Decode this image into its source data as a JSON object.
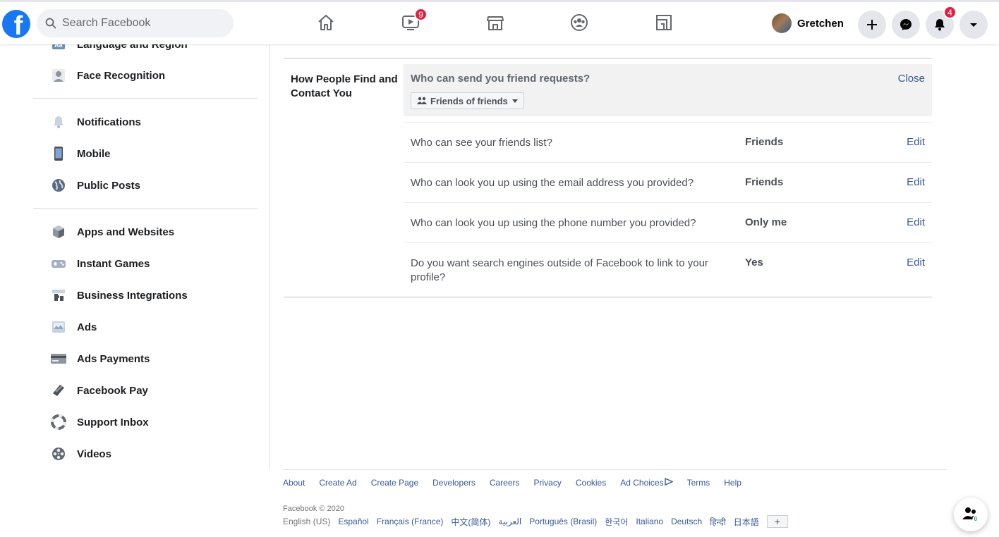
{
  "header": {
    "logo_letter": "f",
    "search_placeholder": "Search Facebook",
    "watch_badge": "9",
    "profile_name": "Gretchen",
    "notifications_badge": "4"
  },
  "sidebar": {
    "items": [
      {
        "label": "Language and Region",
        "icon": "language-icon"
      },
      {
        "label": "Face Recognition",
        "icon": "face-recognition-icon"
      },
      {
        "label": "Notifications",
        "icon": "bell-icon"
      },
      {
        "label": "Mobile",
        "icon": "mobile-icon"
      },
      {
        "label": "Public Posts",
        "icon": "globe-icon"
      },
      {
        "label": "Apps and Websites",
        "icon": "cube-icon"
      },
      {
        "label": "Instant Games",
        "icon": "gamepad-icon"
      },
      {
        "label": "Business Integrations",
        "icon": "puzzle-icon"
      },
      {
        "label": "Ads",
        "icon": "ads-icon"
      },
      {
        "label": "Ads Payments",
        "icon": "credit-card-icon"
      },
      {
        "label": "Facebook Pay",
        "icon": "pay-icon"
      },
      {
        "label": "Support Inbox",
        "icon": "lifebuoy-icon"
      },
      {
        "label": "Videos",
        "icon": "film-reel-icon"
      }
    ]
  },
  "main": {
    "section_title": "How People Find and Contact You",
    "open_question": "Who can send you friend requests?",
    "close_label": "Close",
    "dropdown_value": "Friends of friends",
    "rows": [
      {
        "question": "Who can see your friends list?",
        "value": "Friends",
        "action": "Edit"
      },
      {
        "question": "Who can look you up using the email address you provided?",
        "value": "Friends",
        "action": "Edit"
      },
      {
        "question": "Who can look you up using the phone number you provided?",
        "value": "Only me",
        "action": "Edit"
      },
      {
        "question": "Do you want search engines outside of Facebook to link to your profile?",
        "value": "Yes",
        "action": "Edit"
      }
    ]
  },
  "footer": {
    "links": [
      "About",
      "Create Ad",
      "Create Page",
      "Developers",
      "Careers",
      "Privacy",
      "Cookies",
      "Ad Choices",
      "Terms",
      "Help"
    ],
    "copyright": "Facebook © 2020",
    "current_language": "English (US)",
    "languages": [
      "Español",
      "Français (France)",
      "中文(简体)",
      "العربية",
      "Português (Brasil)",
      "한국어",
      "Italiano",
      "Deutsch",
      "हिन्दी",
      "日本語"
    ],
    "more_languages": "+"
  },
  "contacts": {
    "count": "0"
  }
}
